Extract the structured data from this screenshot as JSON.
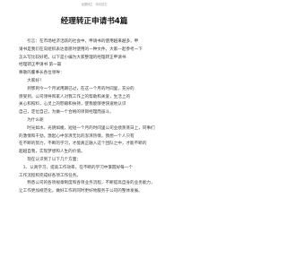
{
  "header": {
    "meta": "经理转正 · 申请范文"
  },
  "document": {
    "title": "经理转正申请书4篇",
    "lines": [
      "引言：在市场经济活跃的社会中，申请书的使用越来越多，申",
      "请书是我们在向组织表达意愿时使用的一种文件。大家一起参考一下",
      "怎么写比较好吧。以下是小编为大家整理的经理转正申请书",
      "经理转正申请书 第一篇",
      "尊敬的董事长各位领导：",
      "大家好！",
      "到鄂到今一个月试用期已过，在这一个月的时间里，充分的",
      "感受到，公司领导和家人对我工作上的帮助和关爱，生活上的",
      "关心和照料，心灵上的慰藉和扶持，使我能够更快速地认识",
      "自己，定位自己，为做一个合格的项目经理而奋斗。",
      "为什么呢",
      "时光如水，光阴如梭，短短一个月的时间里公司业绩蒸蒸日上，同事们",
      "的激情和干劲，激起心中澎湃无比的澎湃热情，我想一个人只有",
      "在不断的努力，不断的学习，才能真正融入这个团队之中，才能不断的",
      "超越自我，实现梦想和人生的价值。",
      "现在认识到了以下几个方面：",
      "1、认真学习，提高工作效率，在不断的学习中掌握好每一个",
      "工作流程和完成好各项工作任务。",
      "熟悉公司的各项规章制度和各项业务流程，不断提高自身的业务能力，",
      "让工作更加规范化，做好工作的同时更好地服务于公司的整体发展。"
    ]
  }
}
